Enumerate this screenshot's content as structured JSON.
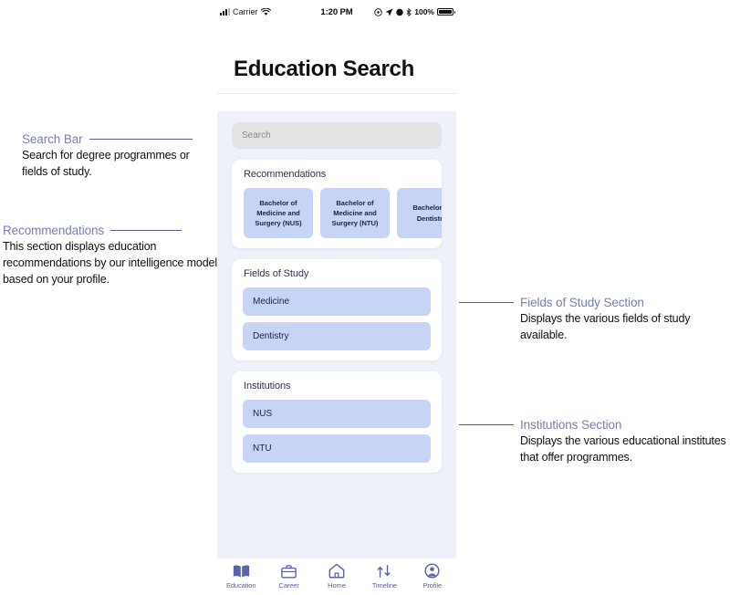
{
  "statusbar": {
    "carrier": "Carrier",
    "time": "1:20 PM",
    "battery_pct": "100%",
    "signal_icon": "cellular-bars-icon",
    "wifi_icon": "wifi-icon",
    "location_icon": "location-arrow-icon",
    "alarm_icon": "alarm-icon",
    "bluetooth_icon": "bluetooth-icon",
    "battery_icon": "battery-full-icon"
  },
  "header": {
    "title": "Education Search"
  },
  "search": {
    "placeholder": "Search",
    "value": ""
  },
  "sections": {
    "recommendations": {
      "title": "Recommendations",
      "items": [
        {
          "label": "Bachelor of Medicine and Surgery (NUS)"
        },
        {
          "label": "Bachelor of Medicine and Surgery (NTU)"
        },
        {
          "label": "Bachelor of Dentistry"
        }
      ]
    },
    "fields_of_study": {
      "title": "Fields of Study",
      "items": [
        {
          "label": "Medicine"
        },
        {
          "label": "Dentistry"
        }
      ]
    },
    "institutions": {
      "title": "Institutions",
      "items": [
        {
          "label": "NUS"
        },
        {
          "label": "NTU"
        }
      ]
    }
  },
  "bottom_nav": {
    "items": [
      {
        "label": "Education",
        "icon": "book-icon",
        "active": true
      },
      {
        "label": "Career",
        "icon": "briefcase-icon",
        "active": false
      },
      {
        "label": "Home",
        "icon": "home-icon",
        "active": false
      },
      {
        "label": "Timeline",
        "icon": "timeline-arrows-icon",
        "active": false
      },
      {
        "label": "Profile",
        "icon": "profile-circle-icon",
        "active": false
      }
    ]
  },
  "annotations": {
    "search_bar": {
      "title": "Search Bar",
      "description": "Search for degree programmes or fields of study."
    },
    "recommendations": {
      "title": "Recommendations",
      "description": "This section displays education recommendations by our intelligence model based on your profile."
    },
    "fields_of_study": {
      "title": "Fields of Study Section",
      "description": "Displays the various fields of study available."
    },
    "institutions": {
      "title": "Institutions Section",
      "description": "Displays the various educational institutes that offer programmes."
    }
  },
  "colors": {
    "accent_chip": "#c7d4f5",
    "annotation_title": "#787fb5",
    "annotation_line": "#5b5f91",
    "screen_bg": "#eef1f9",
    "nav_icon": "#5b62a8"
  }
}
